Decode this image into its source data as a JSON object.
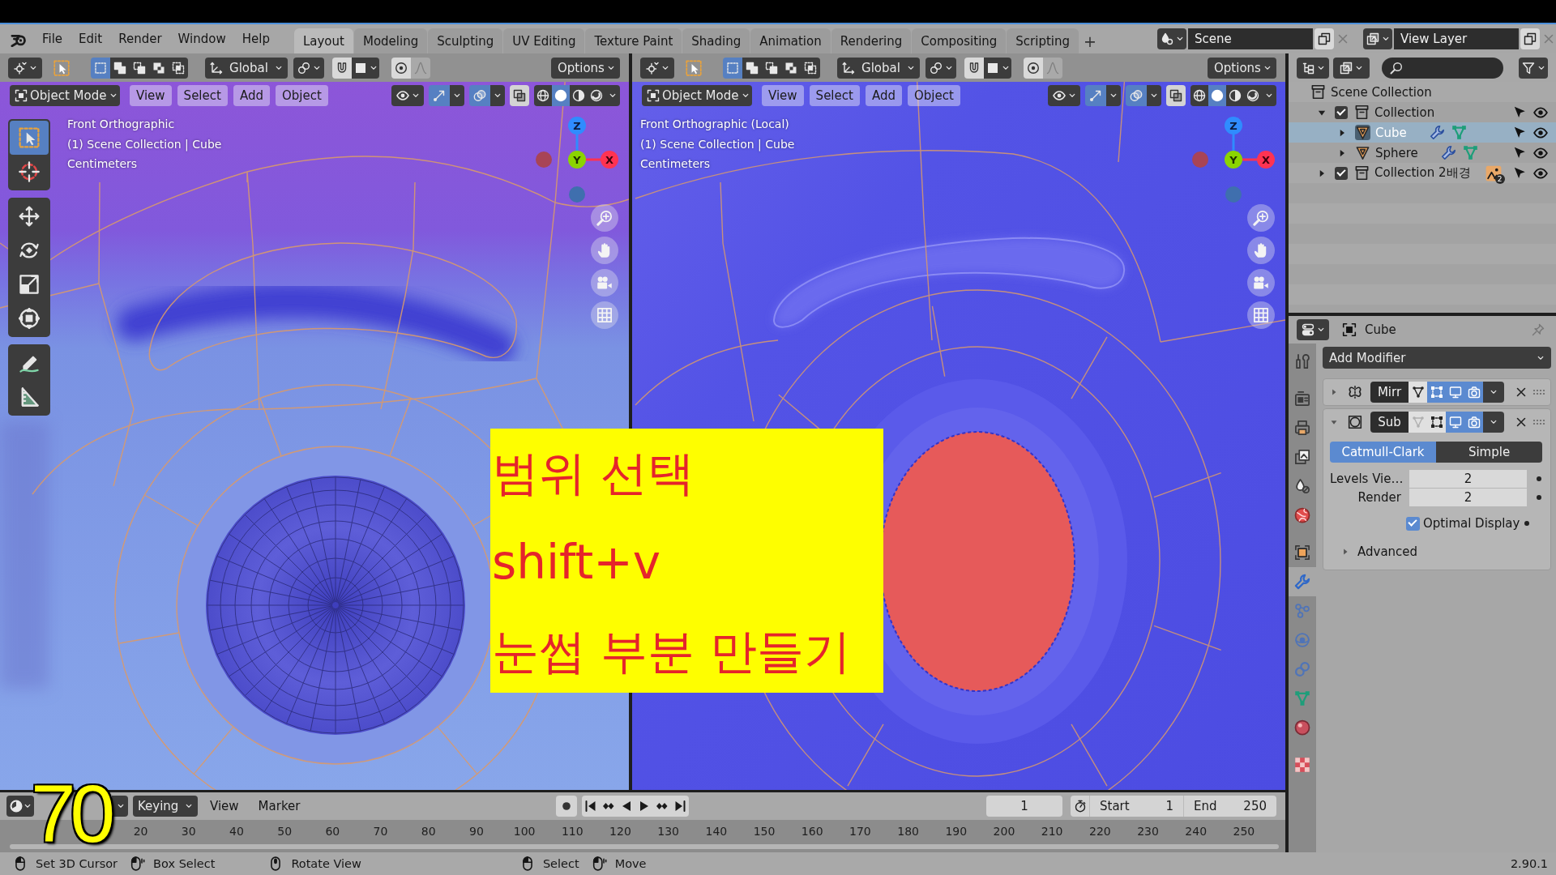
{
  "topbar": {
    "menus": [
      "File",
      "Edit",
      "Render",
      "Window",
      "Help"
    ],
    "workspaces": [
      {
        "label": "Layout",
        "selected": true
      },
      {
        "label": "Modeling",
        "selected": false
      },
      {
        "label": "Sculpting",
        "selected": false
      },
      {
        "label": "UV Editing",
        "selected": false
      },
      {
        "label": "Texture Paint",
        "selected": false
      },
      {
        "label": "Shading",
        "selected": false
      },
      {
        "label": "Animation",
        "selected": false
      },
      {
        "label": "Rendering",
        "selected": false
      },
      {
        "label": "Compositing",
        "selected": false
      },
      {
        "label": "Scripting",
        "selected": false
      }
    ],
    "add_workspace": "+",
    "scene": "Scene",
    "view_layer": "View Layer"
  },
  "viewports": [
    {
      "kind": "textured",
      "select_modes": [
        {
          "kind": "set",
          "selected": true
        },
        {
          "kind": "extend",
          "selected": false
        },
        {
          "kind": "subtract",
          "selected": false
        },
        {
          "kind": "invert",
          "selected": false
        },
        {
          "kind": "intersect",
          "selected": false
        }
      ],
      "orientation": "Global",
      "options": "Options",
      "mode": "Object Mode",
      "menus": [
        "View",
        "Select",
        "Add",
        "Object"
      ],
      "gizmos": true,
      "overlays": true,
      "xray": false,
      "shading": [
        {
          "kind": "wireframe",
          "selected": false
        },
        {
          "kind": "solid",
          "selected": true
        },
        {
          "kind": "material",
          "selected": false
        },
        {
          "kind": "rendered",
          "selected": false
        }
      ],
      "tool_groups": [
        [
          {
            "kind": "select_box",
            "selected": true
          },
          {
            "kind": "cursor",
            "selected": false
          }
        ],
        [
          {
            "kind": "move",
            "selected": false
          },
          {
            "kind": "rotate",
            "selected": false
          },
          {
            "kind": "scale",
            "selected": false
          },
          {
            "kind": "transform",
            "selected": false
          }
        ],
        [
          {
            "kind": "annotate",
            "selected": false
          },
          {
            "kind": "measure",
            "selected": false
          }
        ]
      ],
      "info": [
        "Front Orthographic",
        "(1) Scene Collection | Cube",
        "Centimeters"
      ],
      "gizmo": {
        "x": "X",
        "y": "Y",
        "z": "Z"
      }
    },
    {
      "kind": "selection",
      "select_modes": [
        {
          "kind": "set",
          "selected": true
        },
        {
          "kind": "extend",
          "selected": false
        },
        {
          "kind": "subtract",
          "selected": false
        },
        {
          "kind": "invert",
          "selected": false
        },
        {
          "kind": "intersect",
          "selected": false
        }
      ],
      "orientation": "Global",
      "options": "Options",
      "mode": "Object Mode",
      "menus": [
        "View",
        "Select",
        "Add",
        "Object"
      ],
      "gizmos": true,
      "overlays": true,
      "xray": false,
      "shading": [
        {
          "kind": "wireframe",
          "selected": false
        },
        {
          "kind": "solid",
          "selected": true
        },
        {
          "kind": "material",
          "selected": false
        },
        {
          "kind": "rendered",
          "selected": false
        }
      ],
      "info": [
        "Front Orthographic (Local)",
        "(1) Scene Collection | Cube",
        "Centimeters"
      ],
      "gizmo": {
        "x": "X",
        "y": "Y",
        "z": "Z"
      }
    }
  ],
  "annotation": {
    "lines": [
      "범위 선택",
      "shift+v",
      "눈썹 부분 만들기"
    ]
  },
  "timeline": {
    "keying": "Keying",
    "menus": [
      "View",
      "Marker"
    ],
    "recording": false,
    "current_frame": "1",
    "start_label": "Start",
    "start": "1",
    "end_label": "End",
    "end": "250",
    "ruler": [
      "20",
      "30",
      "40",
      "50",
      "60",
      "70",
      "80",
      "90",
      "100",
      "110",
      "120",
      "130",
      "140",
      "150",
      "160",
      "170",
      "180",
      "190",
      "200",
      "210",
      "220",
      "230",
      "240",
      "250"
    ]
  },
  "step_number": "70",
  "outliner": {
    "root": "Scene Collection",
    "items": [
      {
        "kind": "collection",
        "label": "Collection",
        "checked": true,
        "expanded": true,
        "selected": false,
        "children": [
          {
            "kind": "mesh",
            "label": "Cube",
            "expanded": false,
            "selected": true,
            "modifiers": true,
            "mesh_data": true
          },
          {
            "kind": "mesh",
            "label": "Sphere",
            "expanded": false,
            "selected": false,
            "modifiers": true,
            "mesh_data": true
          }
        ]
      },
      {
        "kind": "collection",
        "label": "Collection 2배경",
        "checked": true,
        "expanded": false,
        "selected": false,
        "image_count": "2"
      }
    ]
  },
  "properties": {
    "object": "Cube",
    "tab_groups": [
      [
        {
          "kind": "tool",
          "selected": false
        }
      ],
      [
        {
          "kind": "render",
          "selected": false
        },
        {
          "kind": "output",
          "selected": false
        },
        {
          "kind": "view_layer",
          "selected": false
        },
        {
          "kind": "scene",
          "selected": false
        },
        {
          "kind": "world",
          "selected": false
        }
      ],
      [
        {
          "kind": "object",
          "selected": false
        },
        {
          "kind": "modifiers",
          "selected": true
        },
        {
          "kind": "particles",
          "selected": false
        },
        {
          "kind": "physics",
          "selected": false
        },
        {
          "kind": "constraints",
          "selected": false
        },
        {
          "kind": "data",
          "selected": false
        },
        {
          "kind": "material",
          "selected": false
        }
      ],
      [
        {
          "kind": "texture",
          "selected": false
        }
      ]
    ],
    "add_modifier": "Add Modifier",
    "modifiers": [
      {
        "kind": "mirror",
        "name": "Mirr",
        "expanded": false,
        "toggles": [
          {
            "kind": "editmode",
            "on": false,
            "disabled": false
          },
          {
            "kind": "cage",
            "on": true,
            "disabled": false
          },
          {
            "kind": "viewport",
            "on": true,
            "disabled": false
          },
          {
            "kind": "render",
            "on": true,
            "disabled": false
          }
        ]
      },
      {
        "kind": "subsurf",
        "name": "Sub",
        "expanded": true,
        "toggles": [
          {
            "kind": "editmode",
            "on": false,
            "disabled": true
          },
          {
            "kind": "cage",
            "on": false,
            "disabled": false
          },
          {
            "kind": "viewport",
            "on": true,
            "disabled": false
          },
          {
            "kind": "render",
            "on": true,
            "disabled": false
          }
        ],
        "settings": {
          "types": [
            {
              "label": "Catmull-Clark",
              "selected": true
            },
            {
              "label": "Simple",
              "selected": false
            }
          ],
          "fields": [
            {
              "label": "Levels Vie…",
              "value": "2"
            },
            {
              "label": "Render",
              "value": "2"
            }
          ],
          "optimal_display": {
            "label": "Optimal Display",
            "checked": true
          },
          "advanced": {
            "label": "Advanced",
            "expanded": false
          }
        }
      }
    ]
  },
  "status_bar": {
    "hints": [
      {
        "kind": "click",
        "label": "Set 3D Cursor"
      },
      {
        "kind": "drag",
        "label": "Box Select"
      },
      {
        "kind": "middle",
        "label": "Rotate View"
      },
      {
        "kind": "click",
        "label": "Select"
      },
      {
        "kind": "drag",
        "label": "Move"
      }
    ],
    "version": "2.90.1"
  }
}
